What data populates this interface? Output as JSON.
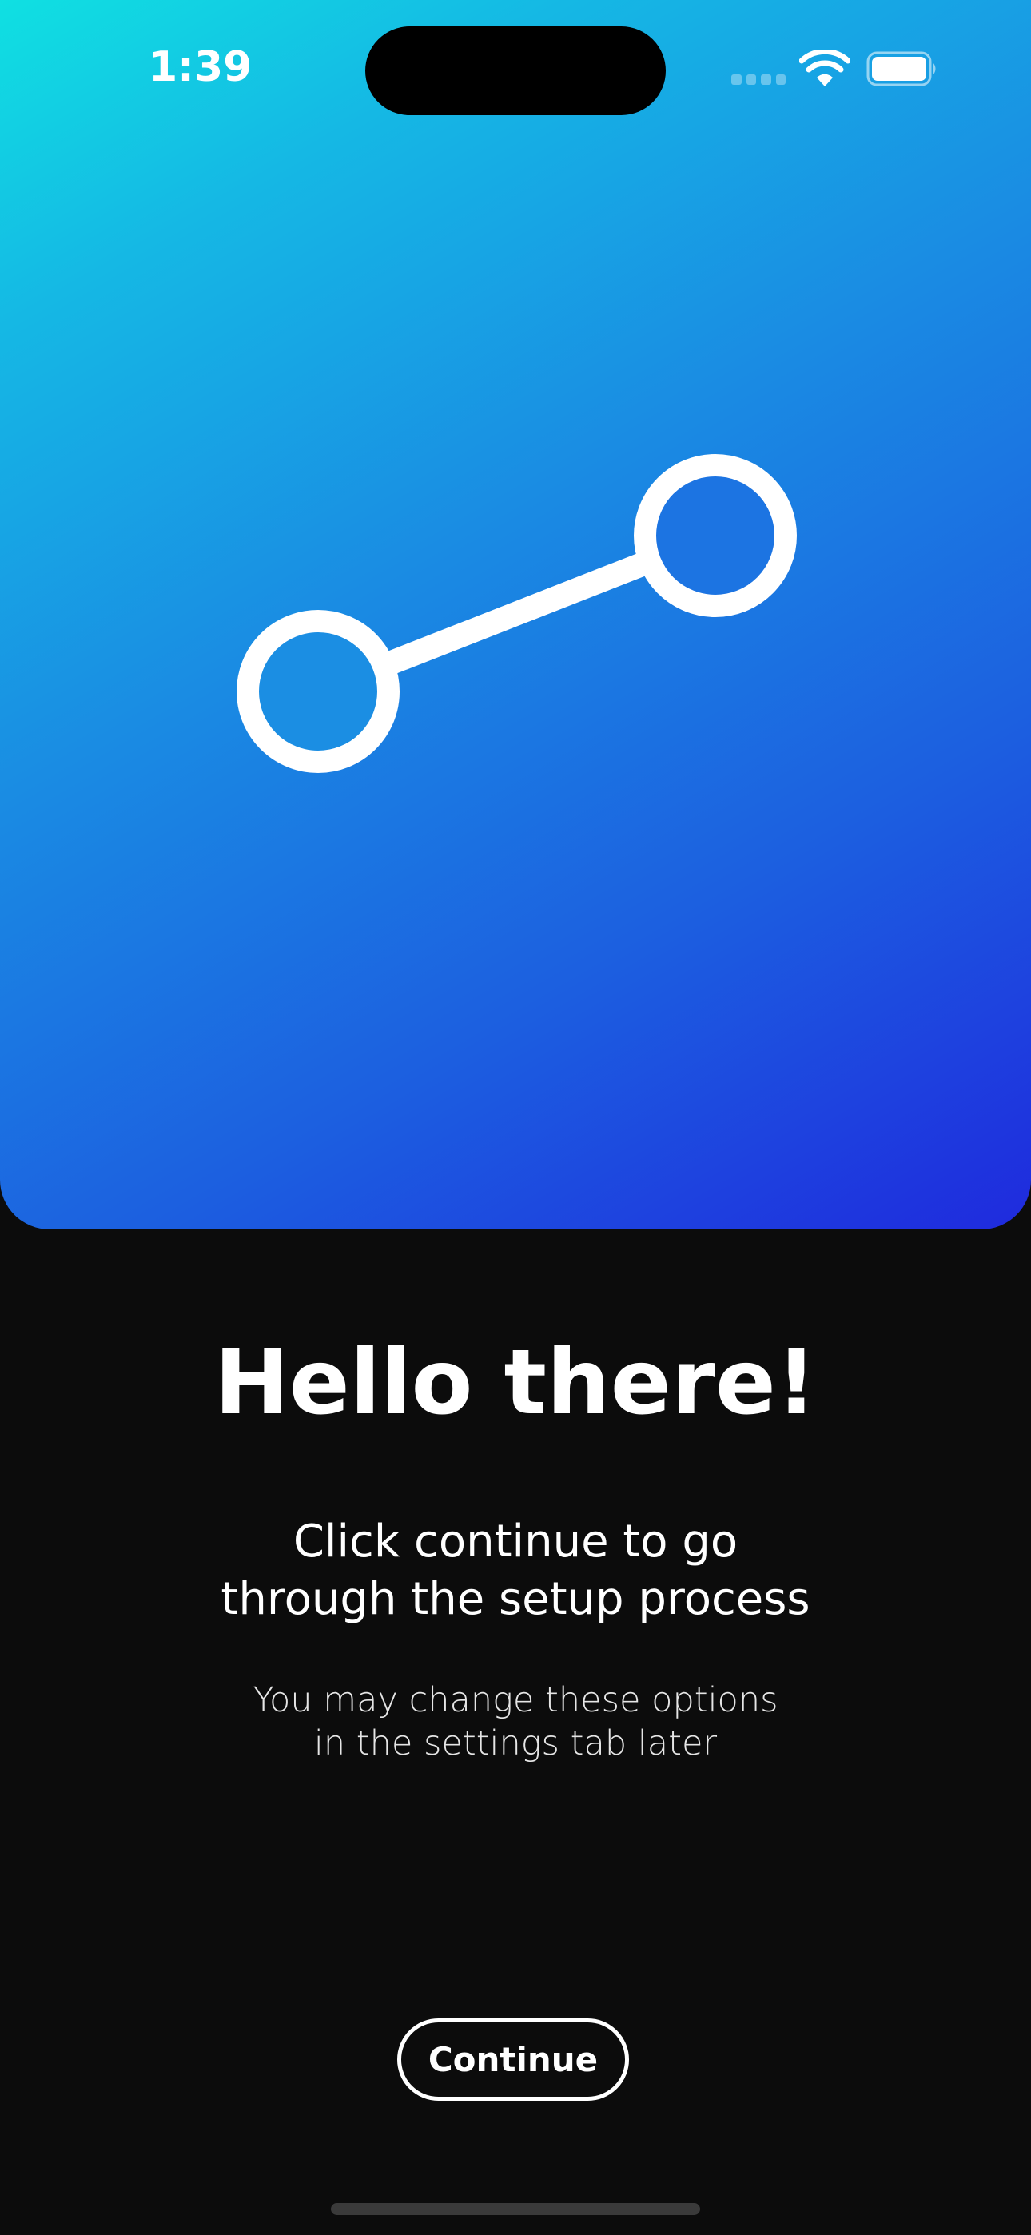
{
  "status_bar": {
    "time": "1:39",
    "icons": [
      "cellular-signal-icon",
      "wifi-icon",
      "battery-icon"
    ]
  },
  "hero": {
    "icon": "connection-icon",
    "gradient_colors": [
      "#10e0e2",
      "#1a8ae3",
      "#1f2ade"
    ]
  },
  "content": {
    "title": "Hello there!",
    "subtitle_line1": "Click continue to go",
    "subtitle_line2": "through the setup process",
    "note_line1": "You may change these options",
    "note_line2": "in the settings tab later"
  },
  "actions": {
    "continue_label": "Continue"
  },
  "colors": {
    "background": "#0c0c0c",
    "text": "#ffffff"
  }
}
